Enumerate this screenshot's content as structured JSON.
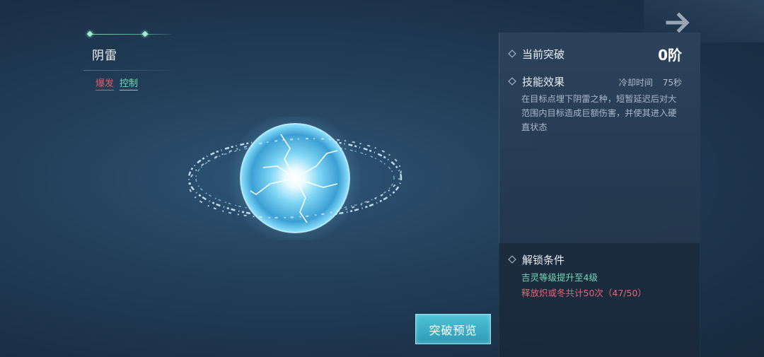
{
  "skill": {
    "name": "阴雷",
    "tags": [
      "爆发",
      "控制"
    ]
  },
  "panel": {
    "breakthrough_label": "当前突破",
    "breakthrough_value": "0阶",
    "effect_label": "技能效果",
    "cooldown_label": "冷却时间",
    "cooldown_value": "75秒",
    "effect_description": "在目标点埋下阴雷之种，短暂延迟后对大范围内目标造成巨额伤害，并使其进入硬直状态",
    "unlock_label": "解锁条件",
    "conditions": [
      "吉灵等级提升至4级",
      "释放炽或冬共计50次（47/50）"
    ]
  },
  "buttons": {
    "preview_label": "突破预览"
  },
  "icons": {
    "next": "arrow-right-icon",
    "bullet": "diamond-icon"
  },
  "colors": {
    "tag_burst": "#e8566a",
    "tag_control": "#6fd9b0",
    "condition_met": "#74d8b4",
    "condition_unmet": "#ef6273",
    "button": "#3aaec6"
  }
}
